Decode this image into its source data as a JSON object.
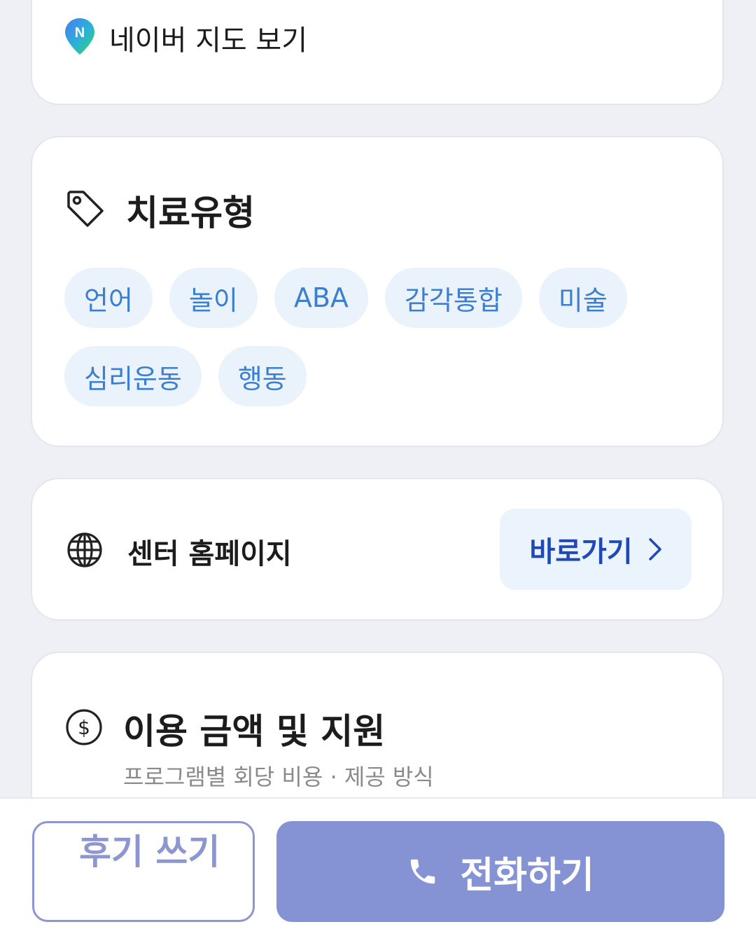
{
  "map": {
    "label": "네이버 지도 보기",
    "icon": "naver-map-pin-icon",
    "icon_letter": "N"
  },
  "therapy": {
    "title": "치료유형",
    "icon": "tag-icon",
    "chips": [
      "언어",
      "놀이",
      "ABA",
      "감각통합",
      "미술",
      "심리운동",
      "행동"
    ]
  },
  "homepage": {
    "label": "센터 홈페이지",
    "icon": "globe-icon",
    "button_label": "바로가기",
    "button_icon": "chevron-right-icon"
  },
  "price": {
    "title": "이용 금액 및 지원",
    "icon": "dollar-circle-icon",
    "subtitle": "프로그램별 회당 비용 · 제공 방식"
  },
  "bottom_bar": {
    "review_label": "후기 쓰기",
    "call_label": "전화하기",
    "call_icon": "phone-icon"
  },
  "colors": {
    "background": "#eef0f5",
    "chip_bg": "#eaf2fc",
    "chip_text": "#3c7ed0",
    "link_text": "#1f49b6",
    "call_button": "#8592d3",
    "review_border": "#8d96cf"
  }
}
